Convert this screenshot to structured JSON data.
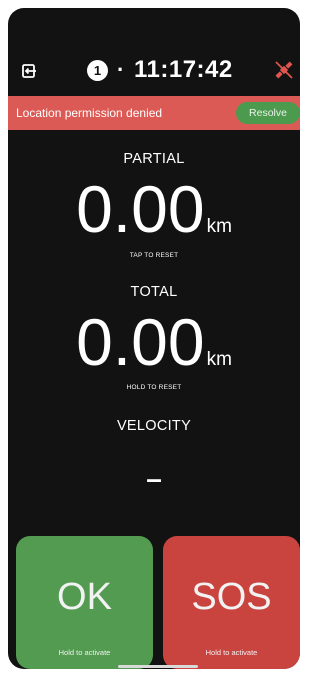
{
  "header": {
    "lap_number": "1",
    "separator": "·",
    "clock": "11:17:42",
    "exit_icon": "exit-icon",
    "gps_icon": "gps-off-icon"
  },
  "alert": {
    "message": "Location permission denied",
    "action_label": "Resolve",
    "color": "#dc5a55",
    "action_color": "#4c9a4e"
  },
  "partial": {
    "label": "PARTIAL",
    "value": "0.00",
    "unit": "km",
    "hint": "TAP TO RESET"
  },
  "total": {
    "label": "TOTAL",
    "value": "0.00",
    "unit": "km",
    "hint": "HOLD TO RESET"
  },
  "velocity": {
    "label": "VELOCITY",
    "value": "–"
  },
  "actions": {
    "ok": {
      "label": "OK",
      "hint": "Hold to activate",
      "color": "#529b50"
    },
    "sos": {
      "label": "SOS",
      "hint": "Hold to activate",
      "color": "#c9433f"
    }
  }
}
